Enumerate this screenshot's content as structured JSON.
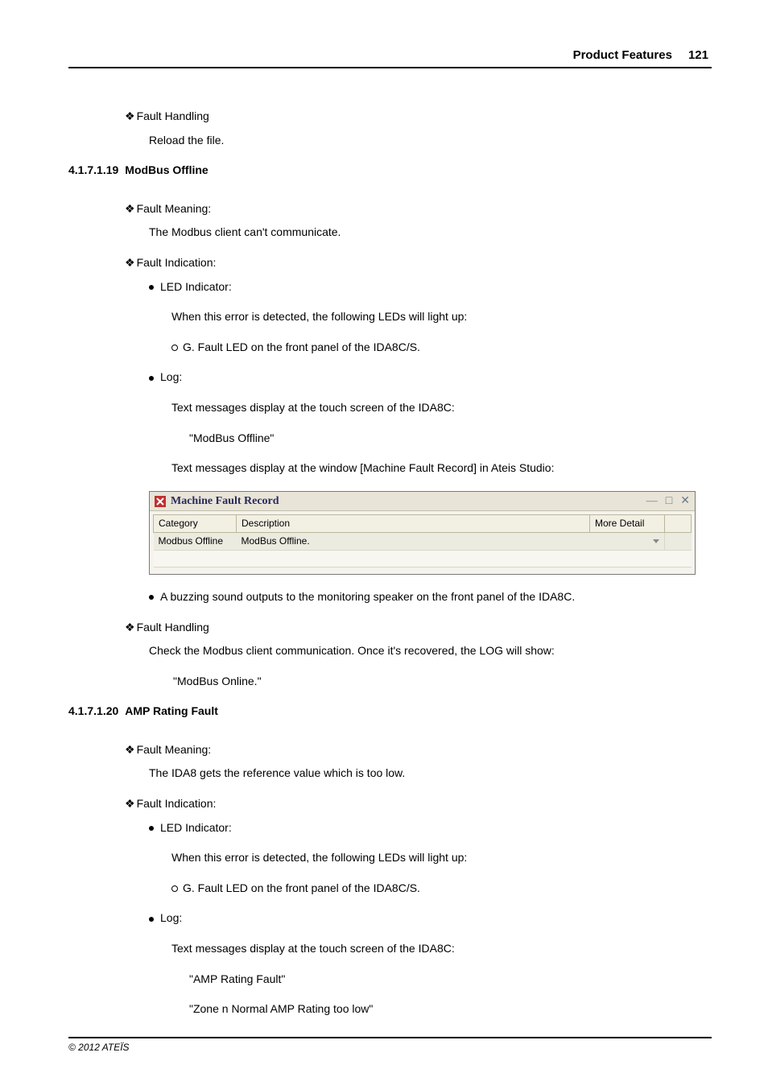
{
  "header": {
    "title": "Product Features",
    "page": "121"
  },
  "s0": {
    "fh": "Fault Handling",
    "fh_text": "Reload the file."
  },
  "s19": {
    "num": "4.1.7.1.19",
    "title": "ModBus Offline",
    "fm_label": "Fault Meaning:",
    "fm_text": "The Modbus client can't communicate.",
    "fi_label": "Fault Indication:",
    "led_label": "LED Indicator:",
    "led_text": "When this error is detected, the following LEDs will light up:",
    "led_item": "G. Fault LED on the front panel of the IDA8C/S.",
    "log_label": "Log:",
    "log_text1": "Text messages display at the touch screen of the IDA8C:",
    "log_msg1": "\"ModBus Offline\"",
    "log_text2": "Text messages display at the window [Machine Fault Record] in Ateis Studio:",
    "buzz_text": "A buzzing sound outputs to the monitoring speaker on the front panel of the IDA8C.",
    "fh_label": "Fault Handling",
    "fh_text": "Check the Modbus client communication. Once it's recovered, the LOG will show:",
    "fh_msg": "\"ModBus Online.\""
  },
  "mfr": {
    "title": "Machine Fault Record",
    "col_category": "Category",
    "col_description": "Description",
    "col_detail": "More Detail",
    "row_category": "Modbus Offline",
    "row_description": "ModBus Offline."
  },
  "s20": {
    "num": "4.1.7.1.20",
    "title": "AMP Rating Fault",
    "fm_label": "Fault Meaning:",
    "fm_text": "The IDA8 gets the reference value which is too low.",
    "fi_label": "Fault Indication:",
    "led_label": "LED Indicator:",
    "led_text": "When this error is detected, the following LEDs will light up:",
    "led_item": "G. Fault LED on the front panel of the IDA8C/S.",
    "log_label": "Log:",
    "log_text1": "Text messages display at the touch screen of the IDA8C:",
    "log_msg1": "\"AMP Rating Fault\"",
    "log_msg2": "\"Zone n Normal AMP Rating too low\""
  },
  "footer": {
    "copyright": "© 2012 ATEÏS"
  }
}
